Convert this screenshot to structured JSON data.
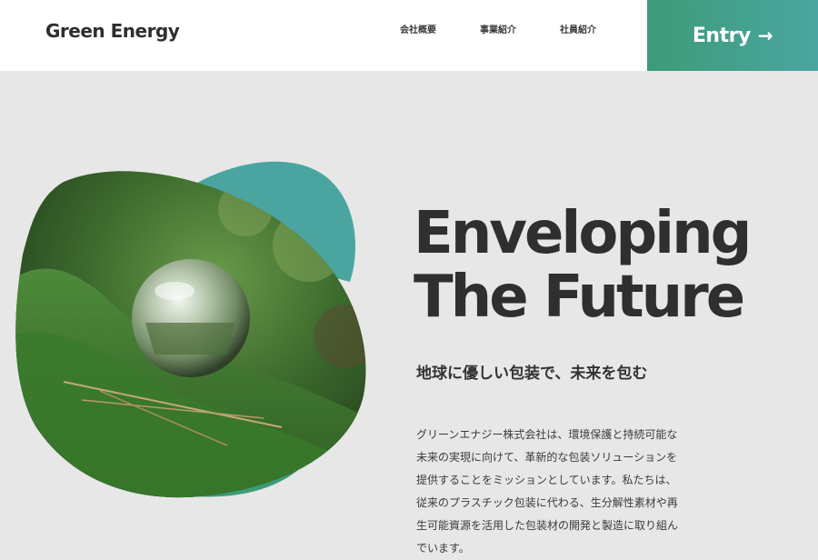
{
  "header": {
    "logo": "Green Energy",
    "nav": [
      {
        "label": "会社概要"
      },
      {
        "label": "事業紹介"
      },
      {
        "label": "社員紹介"
      }
    ],
    "entry_label": "Entry",
    "entry_arrow": "→"
  },
  "hero": {
    "headline_line1": "Enveloping",
    "headline_line2": "The Future",
    "subheadline": "地球に優しい包装で、未来を包む",
    "body": "グリーンエナジー株式会社は、環境保護と持続可能な未来の実現に向けて、革新的な包装ソリューションを提供することをミッションとしています。私たちは、従来のプラスチック包装に代わる、生分解性素材や再生可能資源を活用した包装材の開発と製造に取り組んでいます。"
  },
  "colors": {
    "accent_green": "#3d9c78",
    "accent_teal": "#4aa5a0",
    "background": "#e7e7e7"
  }
}
